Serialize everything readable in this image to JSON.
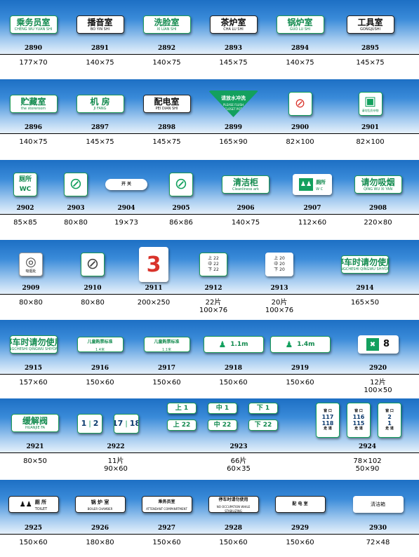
{
  "rows": [
    {
      "items": [
        {
          "code": "2890",
          "size": "177×70",
          "cn": "乘务员室",
          "en": "CHENG WU YUAN SHI",
          "style": "green"
        },
        {
          "code": "2891",
          "size": "140×75",
          "cn": "播音室",
          "en": "BO YIN SHI",
          "style": "black"
        },
        {
          "code": "2892",
          "size": "140×75",
          "cn": "洗脸室",
          "en": "XI LIAN SHI",
          "style": "green"
        },
        {
          "code": "2893",
          "size": "145×75",
          "cn": "茶炉室",
          "en": "CHA LU SHI",
          "style": "black"
        },
        {
          "code": "2894",
          "size": "140×75",
          "cn": "锅炉室",
          "en": "GUO LU SHI",
          "style": "green"
        },
        {
          "code": "2895",
          "size": "145×75",
          "cn": "工具室",
          "en": "GONGJUSHI",
          "style": "black"
        }
      ]
    },
    {
      "items": [
        {
          "code": "2896",
          "size": "140×75",
          "cn": "贮藏室",
          "en": "the storeroom",
          "style": "green"
        },
        {
          "code": "2897",
          "size": "145×75",
          "cn": "机 房",
          "en": "JI FANG",
          "style": "green"
        },
        {
          "code": "2898",
          "size": "145×75",
          "cn": "配电室",
          "en": "PEI DIAN SHI",
          "style": "black"
        },
        {
          "code": "2899",
          "size": "165×90",
          "cn": "请放水冲洗",
          "en": "PLEASE FLUSH CLOSET POT",
          "style": "triangle"
        },
        {
          "code": "2900",
          "size": "82×100",
          "cn": "",
          "en": "",
          "style": "nohand"
        },
        {
          "code": "2901",
          "size": "82×100",
          "cn": "",
          "en": "请勿乱扔杂物",
          "style": "seat"
        }
      ]
    },
    {
      "items": [
        {
          "code": "2902",
          "size": "85×85",
          "cn": "厕所",
          "en": "WC",
          "style": "wc"
        },
        {
          "code": "2903",
          "size": "80×80",
          "cn": "",
          "en": "",
          "style": "nowater"
        },
        {
          "code": "2904",
          "size": "19×73",
          "cn": "开 关",
          "en": "",
          "style": "switch"
        },
        {
          "code": "2905",
          "size": "86×86",
          "cn": "",
          "en": "",
          "style": "nobottle"
        },
        {
          "code": "2906",
          "size": "140×75",
          "cn": "清洁柜",
          "en": "Cleanliness ark",
          "style": "green"
        },
        {
          "code": "2907",
          "size": "112×60",
          "cn": "厕所",
          "en": "W C",
          "style": "toilet"
        },
        {
          "code": "2908",
          "size": "220×80",
          "cn": "请勿吸烟",
          "en": "QING WU XI YAN",
          "style": "green"
        }
      ]
    },
    {
      "items": [
        {
          "code": "2909",
          "size": "80×80",
          "cn": "吸烟处",
          "en": "",
          "style": "smoke"
        },
        {
          "code": "2910",
          "size": "80×80",
          "cn": "",
          "en": "",
          "style": "nosmoke"
        },
        {
          "code": "2911",
          "size": "200×250",
          "cn": "3",
          "en": "",
          "style": "number"
        },
        {
          "code": "2912",
          "size": "22片\n100×76",
          "cn": "上 22|中 22|下 22",
          "en": "",
          "style": "berth"
        },
        {
          "code": "2913",
          "size": "20片\n100×76",
          "cn": "上 20|中 20|下 20",
          "en": "",
          "style": "berth2"
        },
        {
          "code": "2914",
          "size": "165×50",
          "cn": "停车时请勿使用",
          "en": "TINGCHESHI QINGWU SHIYONG",
          "style": "green"
        }
      ]
    },
    {
      "items": [
        {
          "code": "2915",
          "size": "157×60",
          "cn": "停车时请勿使用",
          "en": "TINGCHESHI QINGWU SHIYONG",
          "style": "greenbox"
        },
        {
          "code": "2916",
          "size": "150×60",
          "cn": "儿童购票标准",
          "en": "1.4米",
          "style": "child"
        },
        {
          "code": "2917",
          "size": "150×60",
          "cn": "儿童购票标准",
          "en": "1.1米",
          "style": "child"
        },
        {
          "code": "2918",
          "size": "150×60",
          "cn": "1.1m",
          "en": "",
          "style": "height"
        },
        {
          "code": "2919",
          "size": "150×60",
          "cn": "1.4m",
          "en": "",
          "style": "height"
        },
        {
          "code": "2920",
          "size": "12片\n100×50",
          "cn": "8",
          "en": "",
          "style": "dining"
        }
      ]
    },
    {
      "items": [
        {
          "code": "2921",
          "size": "80×50",
          "cn": "缓解阀",
          "en": "HUANJIE FA",
          "style": "greenbox"
        },
        {
          "code": "2922",
          "size": "11片\n90×60",
          "cn": "",
          "en": "",
          "style": "seatnum"
        },
        {
          "code": "2923",
          "size": "66片\n60×35",
          "cn": "",
          "en": "",
          "style": "berthtags"
        },
        {
          "code": "2924",
          "size": "78×102\n50×90",
          "cn": "",
          "en": "",
          "style": "aisle"
        }
      ]
    },
    {
      "items": [
        {
          "code": "2925",
          "size": "150×60",
          "cn": "厕 所",
          "en": "TOILET",
          "style": "toiletdark"
        },
        {
          "code": "2926",
          "size": "180×80",
          "cn": "锅 炉 室",
          "en": "BOILER CHAMBER",
          "style": "dark"
        },
        {
          "code": "2927",
          "size": "150×60",
          "cn": "乘务员室",
          "en": "ATTENDANT COMPANRTMENT",
          "style": "plate"
        },
        {
          "code": "2928",
          "size": "150×60",
          "cn": "停车时请勿使用",
          "en": "NO OCCUPATION WHILE STABILIZING",
          "style": "plate"
        },
        {
          "code": "2929",
          "size": "150×60",
          "cn": "配 电 室",
          "en": "",
          "style": "plate"
        },
        {
          "code": "2930",
          "size": "72×48",
          "cn": "清洁箱",
          "en": "",
          "style": "plain"
        }
      ]
    }
  ],
  "seat_signs": [
    {
      "a": "1",
      "b": "2"
    },
    {
      "a": "17",
      "b": "18"
    }
  ],
  "berth_tags": [
    "上 1",
    "中 1",
    "下 1",
    "上 22",
    "中 22",
    "下 22"
  ],
  "aisle_signs": [
    {
      "top": "窗 口",
      "nums": [
        "117",
        "118"
      ],
      "bottom": "走 道"
    },
    {
      "top": "窗 口",
      "nums": [
        "116",
        "115"
      ],
      "bottom": "走 道"
    },
    {
      "top": "窗 口",
      "nums": [
        "2",
        "1"
      ],
      "bottom": "走 道"
    }
  ]
}
